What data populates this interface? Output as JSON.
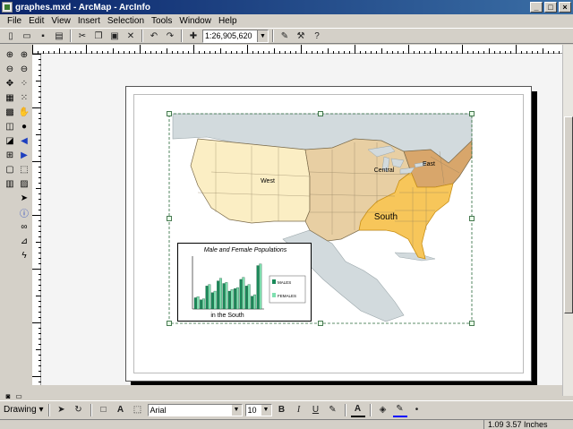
{
  "window": {
    "title": "graphes.mxd - ArcMap - ArcInfo"
  },
  "menu": [
    "File",
    "Edit",
    "View",
    "Insert",
    "Selection",
    "Tools",
    "Window",
    "Help"
  ],
  "toolbar": {
    "scale_value": "1:26,905,620"
  },
  "map": {
    "regions": [
      "West",
      "Central",
      "East",
      "South"
    ]
  },
  "chart": {
    "title": "Male and Female Populations",
    "caption": "in the South",
    "legend": [
      "MALES",
      "FEMALES"
    ],
    "colors": {
      "males": "#1a8a5a",
      "females": "#7fe0b0"
    }
  },
  "chart_data": {
    "type": "bar",
    "title": "Male and Female Populations",
    "xlabel": "in the South",
    "ylabel": "",
    "series": [
      {
        "name": "MALES",
        "values": [
          0.22,
          0.18,
          0.45,
          0.32,
          0.55,
          0.5,
          0.35,
          0.4,
          0.58,
          0.45,
          0.25,
          0.85
        ]
      },
      {
        "name": "FEMALES",
        "values": [
          0.24,
          0.2,
          0.48,
          0.35,
          0.6,
          0.52,
          0.38,
          0.42,
          0.62,
          0.48,
          0.28,
          0.88
        ]
      }
    ],
    "ylim": [
      0,
      1
    ]
  },
  "drawing": {
    "menu_label": "Drawing",
    "font_name": "Arial",
    "font_size": "10"
  },
  "status": {
    "coords": "1.09  3.57 Inches"
  },
  "colors": {
    "west": "#fbeec4",
    "central": "#e8cfa3",
    "east": "#d8a66b",
    "south": "#f7c65a",
    "outline": "#7a6a4a"
  }
}
